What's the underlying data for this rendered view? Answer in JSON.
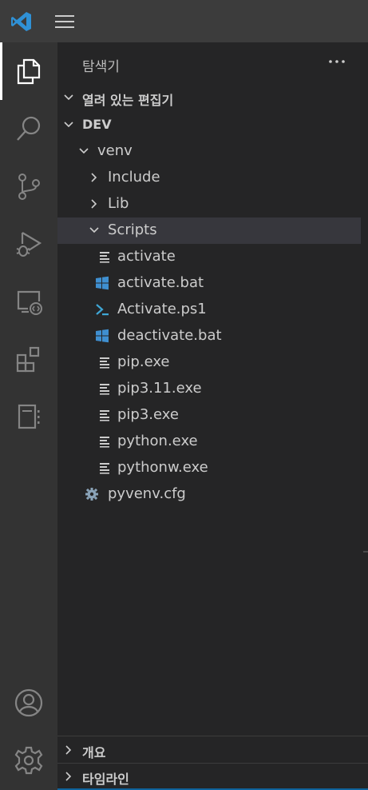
{
  "explorer": {
    "title": "탐색기",
    "more_label": "···"
  },
  "sections": {
    "open_editors": "열려 있는 편집기",
    "workspace": "DEV",
    "outline": "개요",
    "timeline": "타임라인"
  },
  "tree": [
    {
      "label": "venv",
      "type": "folder",
      "expanded": true
    },
    {
      "label": "Include",
      "type": "folder",
      "expanded": false
    },
    {
      "label": "Lib",
      "type": "folder",
      "expanded": false
    },
    {
      "label": "Scripts",
      "type": "folder",
      "expanded": true,
      "selected": true
    },
    {
      "label": "activate",
      "type": "file",
      "icon": "text-file-icon"
    },
    {
      "label": "activate.bat",
      "type": "file",
      "icon": "windows-icon"
    },
    {
      "label": "Activate.ps1",
      "type": "file",
      "icon": "powershell-icon"
    },
    {
      "label": "deactivate.bat",
      "type": "file",
      "icon": "windows-icon"
    },
    {
      "label": "pip.exe",
      "type": "file",
      "icon": "text-file-icon"
    },
    {
      "label": "pip3.11.exe",
      "type": "file",
      "icon": "text-file-icon"
    },
    {
      "label": "pip3.exe",
      "type": "file",
      "icon": "text-file-icon"
    },
    {
      "label": "python.exe",
      "type": "file",
      "icon": "text-file-icon"
    },
    {
      "label": "pythonw.exe",
      "type": "file",
      "icon": "text-file-icon"
    },
    {
      "label": "pyvenv.cfg",
      "type": "file",
      "icon": "gear-file-icon"
    }
  ],
  "activity_bar": [
    "explorer-icon",
    "search-icon",
    "source-control-icon",
    "run-debug-icon",
    "remote-explorer-icon",
    "extensions-icon",
    "notebook-icon",
    "account-icon",
    "settings-gear-icon"
  ],
  "colors": {
    "accent": "#0e639c",
    "windows_icon": "#3f8fd0",
    "powershell_icon": "#3fa7d6",
    "gear_file_icon": "#8aa3b8"
  }
}
